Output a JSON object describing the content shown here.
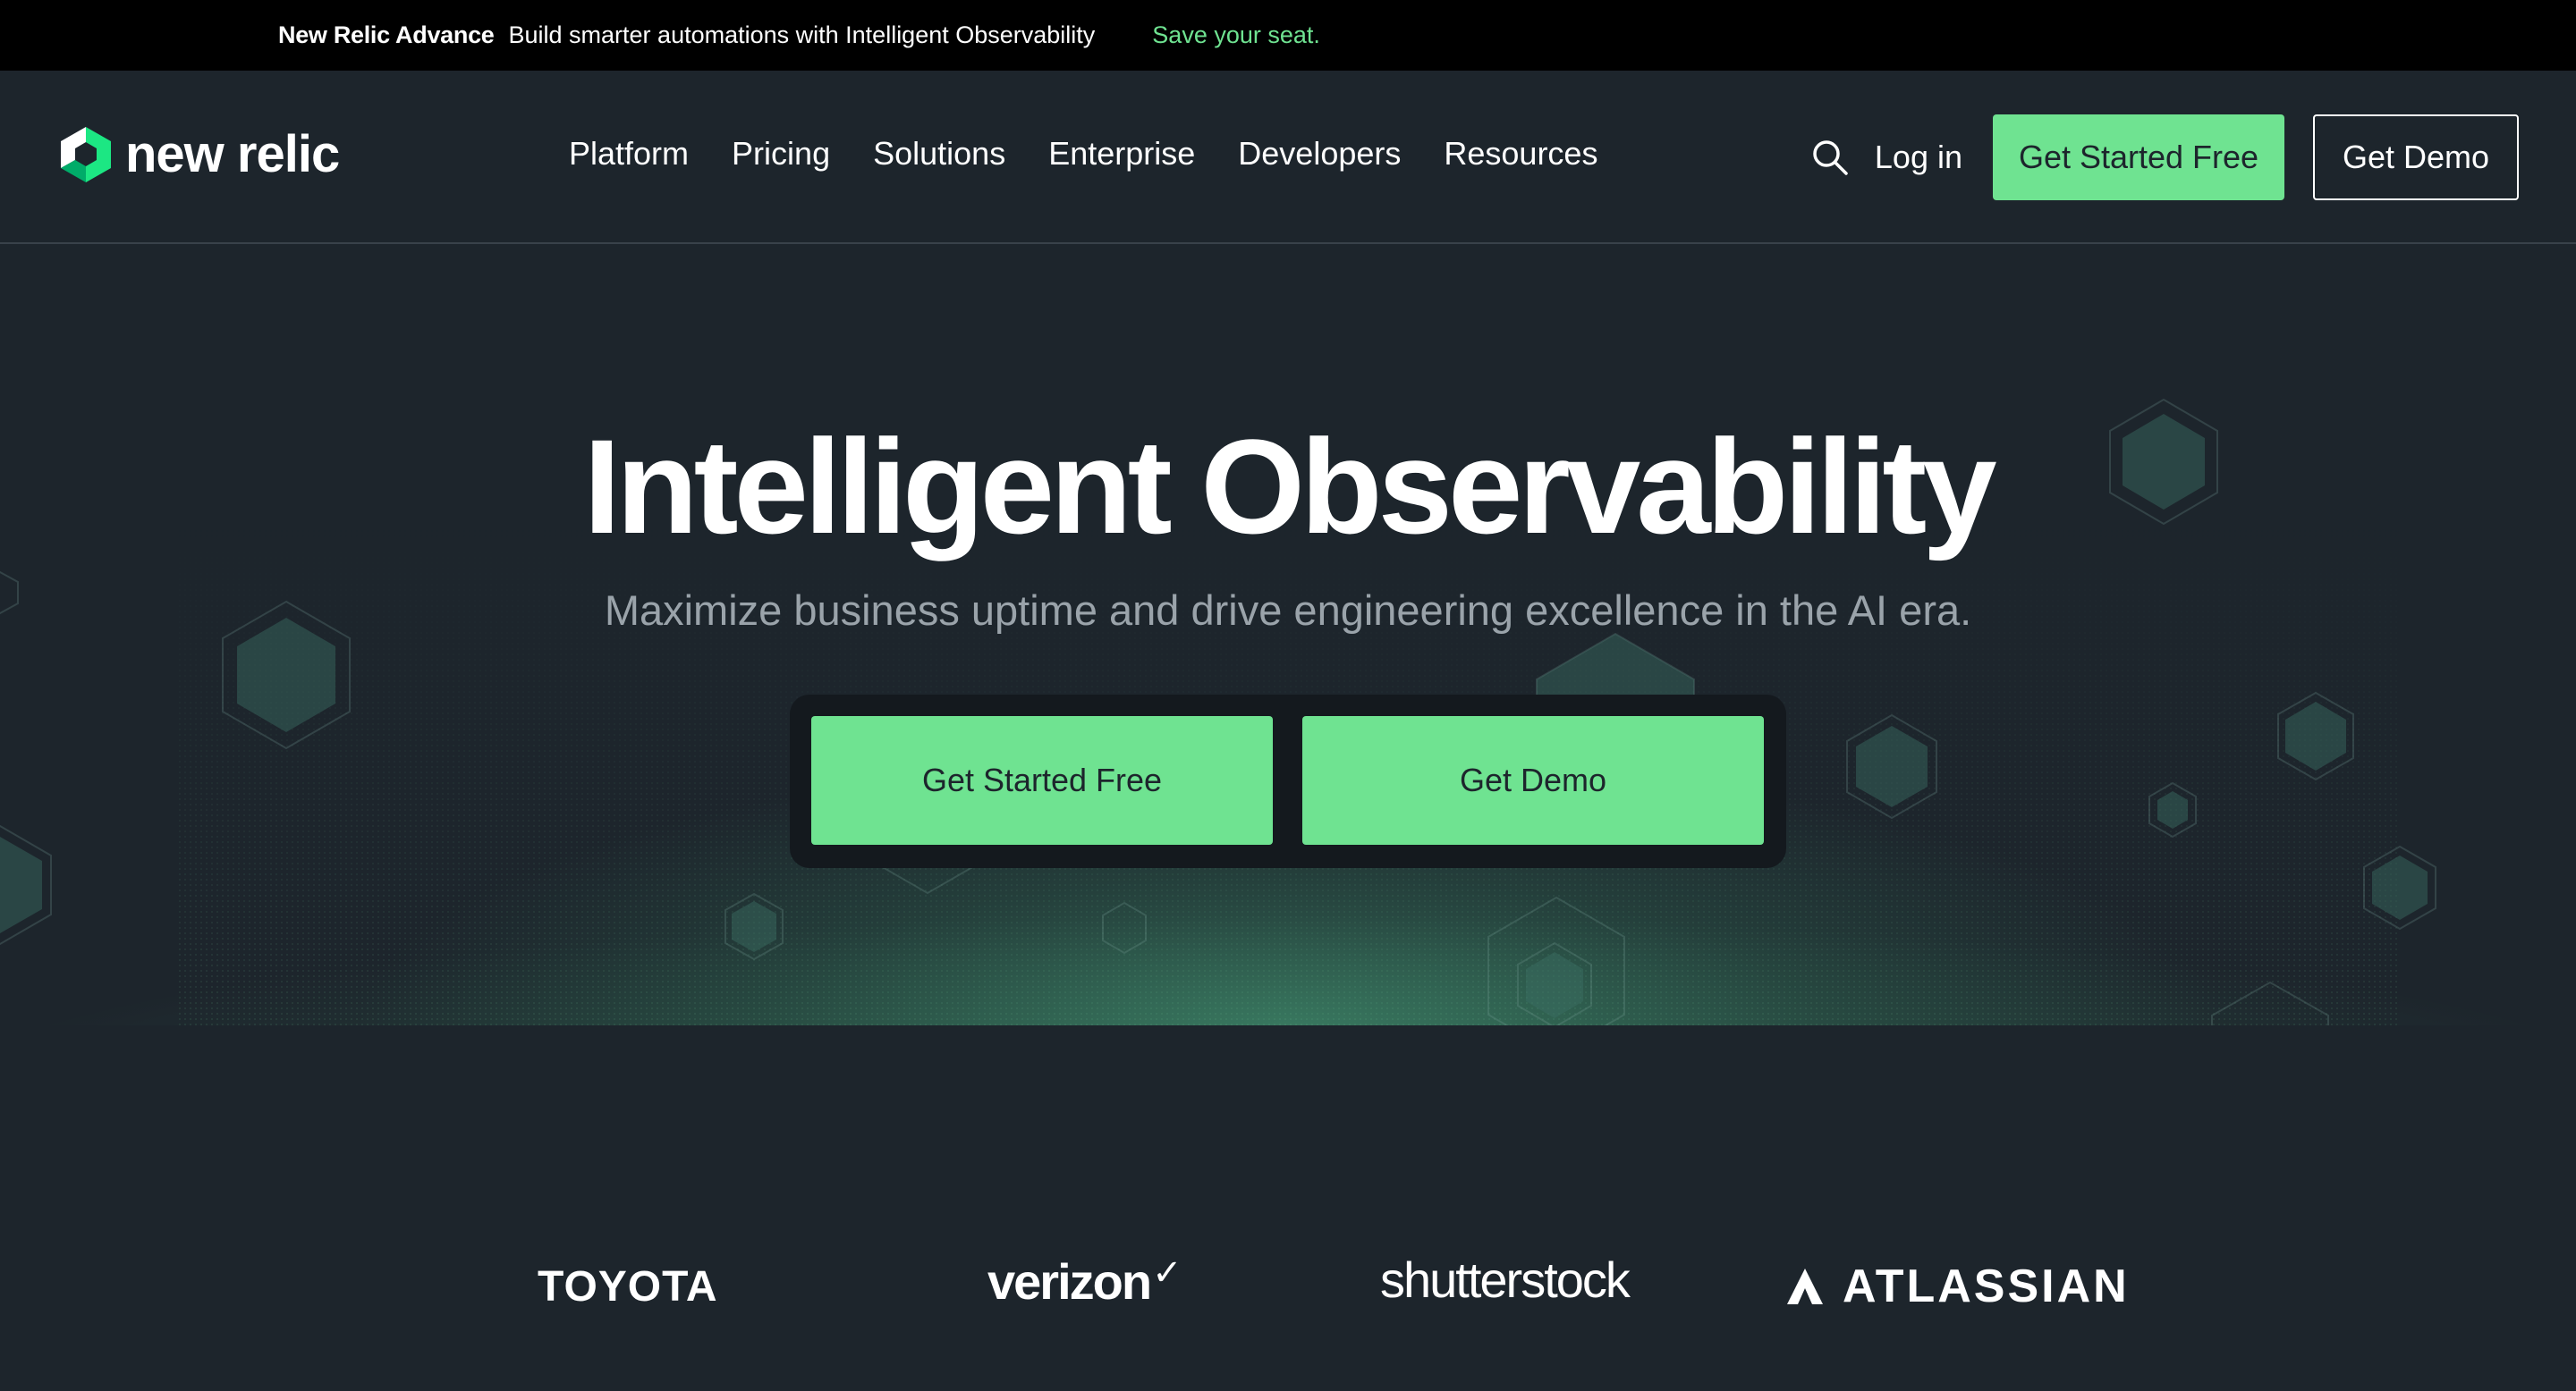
{
  "announcement": {
    "brand": "New Relic Advance",
    "message": "Build smarter automations with Intelligent Observability",
    "cta": "Save your seat."
  },
  "header": {
    "logo_text": "new relic",
    "nav": [
      "Platform",
      "Pricing",
      "Solutions",
      "Enterprise",
      "Developers",
      "Resources"
    ],
    "login": "Log in",
    "get_started": "Get Started Free",
    "get_demo": "Get Demo",
    "icons": {
      "search": "search-icon",
      "logo": "new-relic-logo-icon"
    }
  },
  "hero": {
    "title": "Intelligent Observability",
    "subtitle": "Maximize business uptime and drive engineering excellence in the AI era.",
    "get_started": "Get Started Free",
    "get_demo": "Get Demo"
  },
  "customers": {
    "logos": [
      "TOYOTA",
      "verizon",
      "shutterstock",
      "ATLASSIAN"
    ]
  },
  "colors": {
    "background": "#1d252c",
    "announcement_bg": "#000000",
    "accent": "#6fe391",
    "subtitle": "#9aa3aa"
  }
}
